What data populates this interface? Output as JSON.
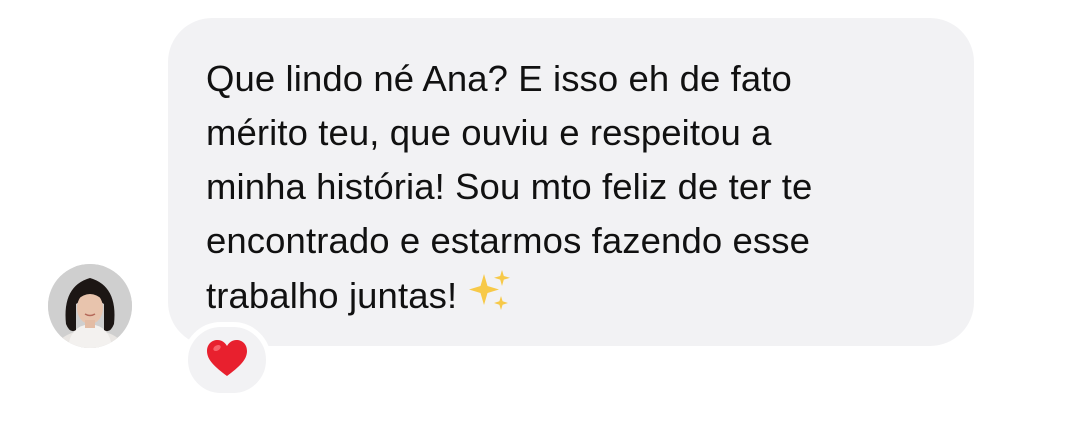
{
  "message": {
    "text": "Que lindo né Ana? E isso eh de fato\nmérito teu, que ouviu e respeitou a\nminha história! Sou mto feliz de ter te\nencontrado e estarmos fazendo esse\ntrabalho juntas!",
    "emoji_icon": "sparkles-icon",
    "bubble_color": "#f2f2f4",
    "text_color": "#111111"
  },
  "sender": {
    "avatar_icon": "avatar"
  },
  "reaction": {
    "emoji_icon": "red-heart-icon",
    "color": "#e8202e"
  }
}
